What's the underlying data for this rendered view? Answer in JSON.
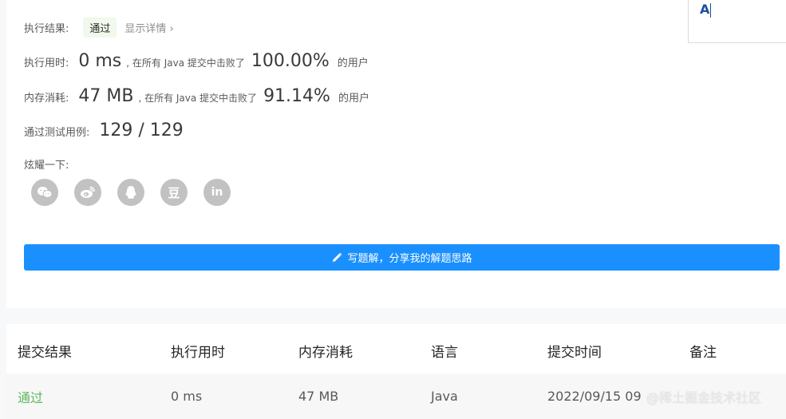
{
  "result": {
    "label": "执行结果:",
    "status": "通过",
    "detail_link": "显示详情 ›"
  },
  "runtime": {
    "label": "执行用时:",
    "value": "0 ms",
    "mid_text": ", 在所有 Java 提交中击败了",
    "percent": "100.00%",
    "suffix": "的用户"
  },
  "memory": {
    "label": "内存消耗:",
    "value": "47 MB",
    "mid_text": ", 在所有 Java 提交中击败了",
    "percent": "91.14%",
    "suffix": "的用户"
  },
  "testcases": {
    "label": "通过测试用例:",
    "value": "129 / 129"
  },
  "share": {
    "label": "炫耀一下:",
    "icons": [
      "wechat-icon",
      "weibo-icon",
      "qq-icon",
      "douban-icon",
      "linkedin-icon"
    ],
    "douban_glyph": "豆",
    "linkedin_glyph": "in"
  },
  "solution_button": "写题解，分享我的解题思路",
  "corner_input": "A",
  "table": {
    "headers": [
      "提交结果",
      "执行用时",
      "内存消耗",
      "语言",
      "提交时间",
      "备注"
    ],
    "rows": [
      {
        "status": "通过",
        "runtime": "0 ms",
        "memory": "47 MB",
        "language": "Java",
        "time": "2022/09/15 09"
      }
    ]
  },
  "watermark": "@稀土掘金技术社区",
  "colors": {
    "accent": "#1a90ff",
    "pass": "#5cb85c",
    "badge_bg": "#f0f9eb",
    "icon_gray": "#c2c2c2"
  }
}
